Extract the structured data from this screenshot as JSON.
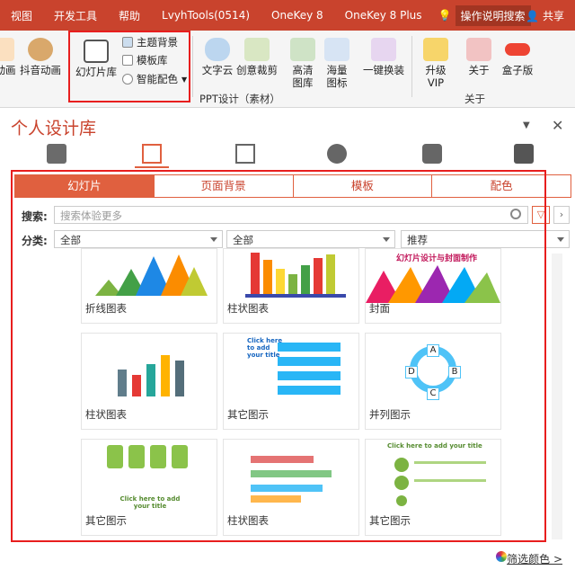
{
  "topbar": {
    "tabs": [
      "视图",
      "开发工具",
      "帮助",
      "LvyhTools(0514)",
      "OneKey 8",
      "OneKey 8 Plus"
    ],
    "search": "操作说明搜索",
    "share": "共享"
  },
  "ribbon": {
    "left_items": [
      "动画",
      "抖音动画"
    ],
    "slides_lib": "幻灯片库",
    "small_items": [
      "主题背景",
      "模板库",
      "智能配色"
    ],
    "word_cloud": "文字云",
    "creative_crop": "创意裁剪",
    "hd_images": "高清图库",
    "icons": "海量图标",
    "one_key_replace": "一键换装",
    "upgrade_vip": "升级VIP",
    "about": "关于",
    "boxed": "盒子版",
    "group_ppt": "PPT设计（素材）",
    "group_about": "关于"
  },
  "panel": {
    "title": "个人设计库",
    "tabs": [
      "幻灯片",
      "页面背景",
      "模板",
      "配色"
    ],
    "search_label": "搜索:",
    "search_placeholder": "搜索体验更多",
    "category_label": "分类:",
    "filter1": "全部",
    "filter2": "全部",
    "filter3": "推荐"
  },
  "cards": [
    {
      "caption": "折线图表"
    },
    {
      "caption": "柱状图表"
    },
    {
      "caption": "封面",
      "text": "幻灯片设计与封面制作"
    },
    {
      "caption": "柱状图表"
    },
    {
      "caption": "其它图示",
      "text": "Click here to add your title"
    },
    {
      "caption": "并列图示",
      "letters": [
        "A",
        "B",
        "C",
        "D"
      ]
    },
    {
      "caption": "其它图示",
      "text": "Click here to add your title"
    },
    {
      "caption": "柱状图表"
    },
    {
      "caption": "其它图示",
      "text": "Click here to add your title"
    }
  ],
  "footer": {
    "filter_color": "筛选颜色 >"
  }
}
